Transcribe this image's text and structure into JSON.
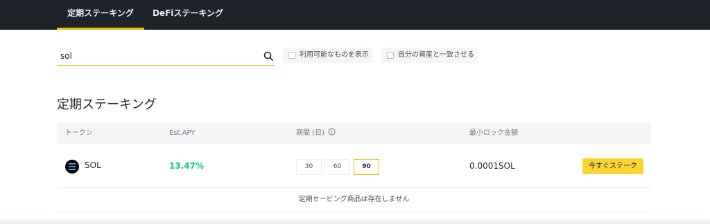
{
  "tabs": [
    {
      "label": "定期ステーキング",
      "active": true
    },
    {
      "label": "DeFiステーキング",
      "active": false
    }
  ],
  "search": {
    "value": "sol",
    "placeholder": ""
  },
  "filters": {
    "available_only": "利用可能なものを表示",
    "match_assets": "自分の資産と一致させる"
  },
  "section": {
    "title": "定期ステーキング"
  },
  "table": {
    "headers": {
      "token": "トークン",
      "apy": "Est.APY",
      "duration": "期間 (日)",
      "min_lock": "最小ロック金額"
    },
    "rows": [
      {
        "token": "SOL",
        "apy": "13.47%",
        "durations": [
          "30",
          "60",
          "90"
        ],
        "selected_duration": "90",
        "min_lock": "0.0001SOL",
        "action": "今すぐステーク"
      }
    ],
    "footer_note": "定期セービング商品は存在しません"
  },
  "colors": {
    "accent": "#f0b90b",
    "positive": "#0ecb81",
    "topbar": "#1e2329"
  }
}
